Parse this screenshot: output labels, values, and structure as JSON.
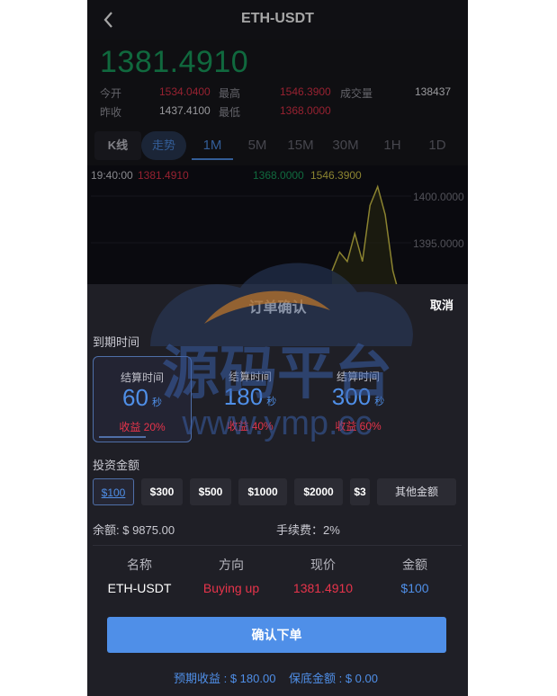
{
  "header": {
    "title": "ETH-USDT"
  },
  "price": {
    "last": "1381.4910",
    "open_label": "今开",
    "open": "1534.0400",
    "high_label": "最高",
    "high": "1546.3900",
    "volume_label": "成交量",
    "volume": "138437",
    "prev_label": "昨收",
    "prev": "1437.4100",
    "low_label": "最低",
    "low": "1368.0000"
  },
  "tabs": [
    "K线",
    "走势",
    "1M",
    "5M",
    "15M",
    "30M",
    "1H",
    "1D"
  ],
  "chart": {
    "time": "19:40:00",
    "v1": "1381.4910",
    "v2": "1368.0000",
    "v3": "1546.3900",
    "ytick1": "1400.0000",
    "ytick2": "1395.0000"
  },
  "chart_data": {
    "type": "line",
    "title": "",
    "xlabel": "",
    "ylabel": "",
    "y_ticks": [
      "1400.0000",
      "1395.0000"
    ],
    "series": [
      {
        "values": [
          1392,
          1394,
          1393,
          1396,
          1393,
          1399,
          1401,
          1398,
          1392,
          1389
        ]
      }
    ]
  },
  "modal": {
    "title": "订单确认",
    "cancel": "取消",
    "expiry_label": "到期时间",
    "expiry_options": [
      {
        "label": "结算时间",
        "num": "60",
        "unit": "秒",
        "yield": "收益 20%"
      },
      {
        "label": "结算时间",
        "num": "180",
        "unit": "秒",
        "yield": "收益 40%"
      },
      {
        "label": "结算时间",
        "num": "300",
        "unit": "秒",
        "yield": "收益 60%"
      }
    ],
    "amount_label": "投资金额",
    "amounts": [
      "$100",
      "$300",
      "$500",
      "$1000",
      "$2000",
      "$3"
    ],
    "other_amount": "其他金额",
    "balance": "余额: $ 9875.00",
    "fee": "手续费：2%",
    "columns": [
      "名称",
      "方向",
      "现价",
      "金额"
    ],
    "row": {
      "name": "ETH-USDT",
      "direction": "Buying up",
      "price": "1381.4910",
      "amount": "$100"
    },
    "confirm": "确认下单",
    "expected": "预期收益 : $ 180.00",
    "margin": "保底金额 : $ 0.00"
  },
  "watermark": {
    "text": "源码平台",
    "url": "www.ymp.cc"
  },
  "colors": {
    "accent": "#4f8fe8",
    "up": "#1aa260",
    "down": "#e7344b",
    "background": "#17171c"
  }
}
